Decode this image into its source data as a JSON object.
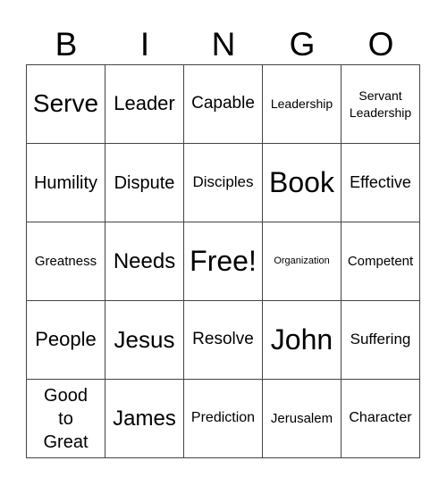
{
  "header": [
    "B",
    "I",
    "N",
    "G",
    "O"
  ],
  "cells": [
    [
      "Serve",
      "Leader",
      "Capable",
      "Leadership",
      "Servant Leadership"
    ],
    [
      "Humility",
      "Dispute",
      "Disciples",
      "Book",
      "Effective"
    ],
    [
      "Greatness",
      "Needs",
      "Free!",
      "Organization",
      "Competent"
    ],
    [
      "People",
      "Jesus",
      "Resolve",
      "John",
      "Suffering"
    ],
    [
      "Good to Great",
      "James",
      "Prediction",
      "Jerusalem",
      "Character"
    ]
  ]
}
